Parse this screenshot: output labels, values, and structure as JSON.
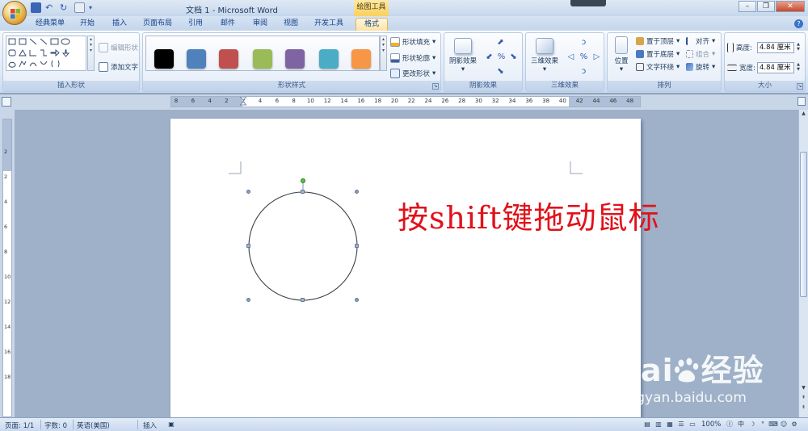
{
  "window": {
    "title": "文档 1 - Microsoft Word",
    "context_tool": "绘图工具"
  },
  "tabs": [
    "经典菜单",
    "开始",
    "插入",
    "页面布局",
    "引用",
    "邮件",
    "审阅",
    "视图",
    "开发工具",
    "格式"
  ],
  "active_tab": "格式",
  "ribbon": {
    "insert_shapes": {
      "label": "插入形状",
      "edit_shape": "编辑形状",
      "add_text": "添加文字"
    },
    "shape_styles": {
      "label": "形状样式",
      "swatches": [
        "#000000",
        "#4f81bd",
        "#c0504d",
        "#9bbb59",
        "#8064a2",
        "#4bacc6",
        "#f79646"
      ],
      "fill": "形状填充",
      "outline": "形状轮廓",
      "change_shape": "更改形状"
    },
    "shadow_effects": {
      "label": "阴影效果",
      "button": "阴影效果"
    },
    "threed_effects": {
      "label": "三维效果",
      "button": "三维效果"
    },
    "arrange": {
      "label": "排列",
      "position": "位置",
      "bring_front": "置于顶层",
      "send_back": "置于底层",
      "text_wrap": "文字环绕",
      "align": "对齐",
      "group": "组合",
      "rotate": "旋转"
    },
    "size": {
      "label": "大小",
      "height_label": "高度:",
      "height_value": "4.84 厘米",
      "width_label": "宽度:",
      "width_value": "4.84 厘米"
    }
  },
  "ruler": {
    "numbers": [
      "8",
      "6",
      "4",
      "2",
      "2",
      "4",
      "6",
      "8",
      "10",
      "12",
      "14",
      "16",
      "18",
      "20",
      "22",
      "24",
      "26",
      "28",
      "30",
      "32",
      "34",
      "36",
      "38",
      "40",
      "42",
      "44",
      "46",
      "48"
    ]
  },
  "vruler": {
    "numbers": [
      "2",
      "2",
      "4",
      "6",
      "8",
      "10",
      "12",
      "14",
      "16",
      "18"
    ]
  },
  "document": {
    "annotation": "按shift键拖动鼠标",
    "watermark_brand": "Bai",
    "watermark_site": "经验",
    "watermark_url": "jingyan.baidu.com"
  },
  "statusbar": {
    "page": "页面: 1/1",
    "words": "字数: 0",
    "language": "英语(美国)",
    "mode": "插入",
    "zoom": "100%",
    "ime": "中"
  }
}
